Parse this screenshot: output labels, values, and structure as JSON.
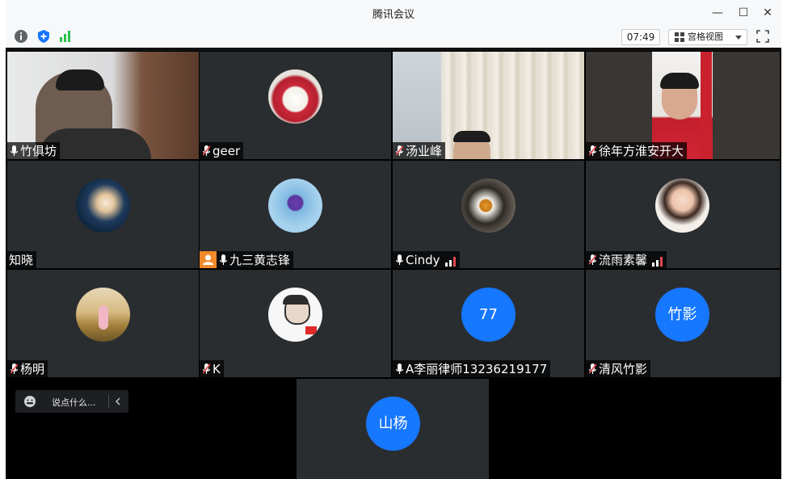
{
  "window": {
    "title": "腾讯会议",
    "minimize": "—",
    "maximize": "☐",
    "close": "✕"
  },
  "toolbar": {
    "time": "07:49",
    "view_label": "宫格视图",
    "info_icon": "info-icon",
    "shield_icon": "shield-icon",
    "signal_icon": "signal-icon",
    "colors": {
      "shield": "#1677ff",
      "signal": "#27c24c"
    }
  },
  "participants": [
    {
      "name": "竹俱坊",
      "mic": "on"
    },
    {
      "name": "geer",
      "mic": "muted"
    },
    {
      "name": "汤业峰",
      "mic": "muted"
    },
    {
      "name": "徐年方淮安开大",
      "mic": "muted"
    },
    {
      "name": "知晓",
      "mic": "none"
    },
    {
      "name": "九三黄志锋",
      "mic": "on",
      "host_badge": true
    },
    {
      "name": "Cindy",
      "mic": "on",
      "signal": true
    },
    {
      "name": "流雨素馨",
      "mic": "muted",
      "signal": true
    },
    {
      "name": "杨明",
      "mic": "muted"
    },
    {
      "name": "K",
      "mic": "muted"
    },
    {
      "name": "A李丽律师13236219177",
      "mic": "on",
      "avatar_text": "77"
    },
    {
      "name": "清风竹影",
      "mic": "muted",
      "avatar_text": "竹影"
    },
    {
      "name": "",
      "avatar_text": "山杨"
    }
  ],
  "chat": {
    "placeholder": "说点什么..."
  },
  "colors": {
    "tile_bg": "#2a2d30",
    "avatar_blue": "#1677ff",
    "muted_red": "#e5484d"
  }
}
